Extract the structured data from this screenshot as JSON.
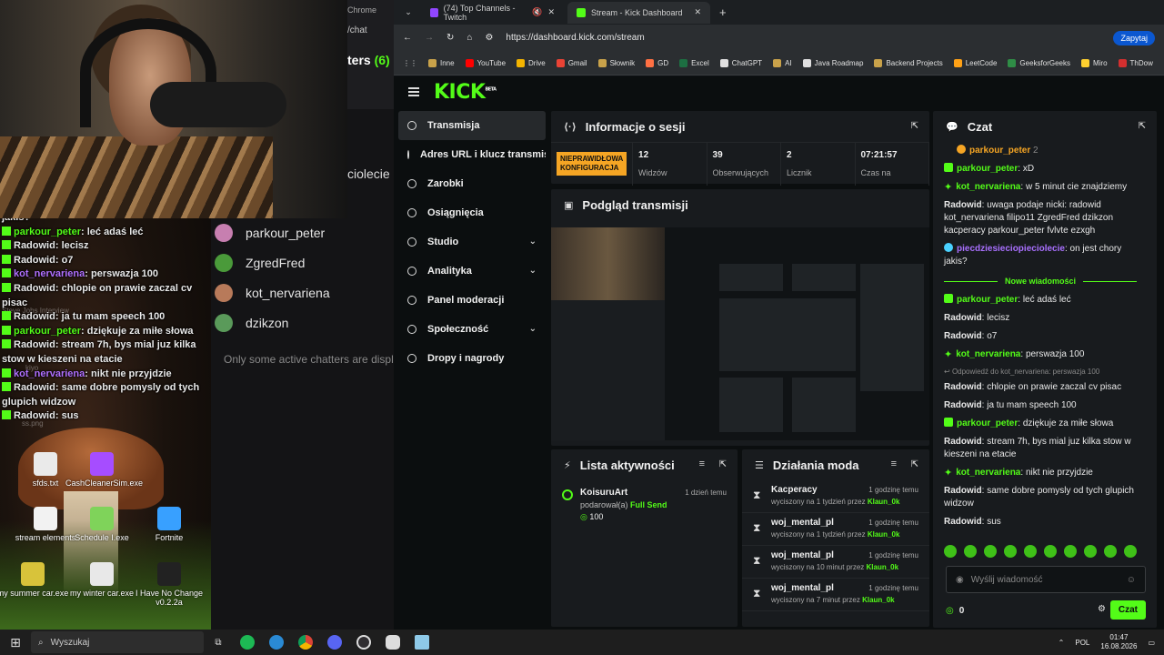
{
  "desktop": {
    "icons": [
      {
        "label": "sfds.txt",
        "color": "#eaeaea"
      },
      {
        "label": "CashCleanerSim.exe",
        "color": "#a64dff"
      },
      {
        "label": "stream elements",
        "color": "#f2f2f2"
      },
      {
        "label": "Schedule I.exe",
        "color": "#7fd35a"
      },
      {
        "label": "Fortnite",
        "color": "#38a0ff"
      },
      {
        "label": "my summer car.exe",
        "color": "#d8c33a"
      },
      {
        "label": "my winter car.exe",
        "color": "#e8e8e8"
      },
      {
        "label": "I Have No Change v0.2.2a",
        "color": "#222"
      }
    ],
    "faint_labels": [
      "Steve Jobs Interview",
      "kiyo",
      "ss.png"
    ]
  },
  "overlay_chat": {
    "first_line": "jakis?",
    "messages": [
      {
        "user": "parkour_peter",
        "text": "leć adaś leć",
        "color": "green"
      },
      {
        "user": "Radowid",
        "text": "lecisz",
        "color": "white"
      },
      {
        "user": "Radowid",
        "text": "o7",
        "color": "white"
      },
      {
        "user": "kot_nervariena",
        "text": "perswazja 100",
        "color": "purple"
      },
      {
        "user": "Radowid",
        "text": "chlopie on prawie zaczal cv pisac",
        "color": "white"
      },
      {
        "user": "Radowid",
        "text": "ja tu mam speech 100",
        "color": "white"
      },
      {
        "user": "parkour_peter",
        "text": "dziękuje za miłe słowa",
        "color": "green"
      },
      {
        "user": "Radowid",
        "text": "stream 7h, bys mial juz kilka stow w kieszeni na etacie",
        "color": "white"
      },
      {
        "user": "kot_nervariena",
        "text": "nikt nie przyjdzie",
        "color": "purple"
      },
      {
        "user": "Radowid",
        "text": "same dobre pomysly od tych glupich widzow",
        "color": "white"
      },
      {
        "user": "Radowid",
        "text": "sus",
        "color": "white"
      }
    ]
  },
  "twitch": {
    "chrome_label": "Chrome",
    "chat_url": "/chat",
    "chatters_label": "ters",
    "chatters_count": "(6)",
    "partial_name": "ciolecie",
    "chatters": [
      {
        "name": "parkour_peter",
        "color": "#c77fb0"
      },
      {
        "name": "ZgredFred",
        "color": "#4a9a3a"
      },
      {
        "name": "kot_nervariena",
        "color": "#b87a5a"
      },
      {
        "name": "dzikzon",
        "color": "#5a9a5a"
      }
    ],
    "note": "Only some active chatters are displayed"
  },
  "browser": {
    "tabs": [
      {
        "label": "(74) Top Channels - Twitch",
        "icon_color": "#9146ff"
      },
      {
        "label": "Stream - Kick Dashboard",
        "icon_color": "#53fc18"
      }
    ],
    "url": "https://dashboard.kick.com/stream",
    "ask_label": "Zapytaj",
    "bookmarks": [
      {
        "label": "Inne",
        "color": "#c9a24a"
      },
      {
        "label": "YouTube",
        "color": "#ff0000"
      },
      {
        "label": "Drive",
        "color": "#f4b400"
      },
      {
        "label": "Gmail",
        "color": "#ea4335"
      },
      {
        "label": "Słownik",
        "color": "#c9a24a"
      },
      {
        "label": "GD",
        "color": "#ff7043"
      },
      {
        "label": "Excel",
        "color": "#1d6f42"
      },
      {
        "label": "ChatGPT",
        "color": "#e0e0e0"
      },
      {
        "label": "AI",
        "color": "#c9a24a"
      },
      {
        "label": "Java Roadmap",
        "color": "#e0e0e0"
      },
      {
        "label": "Backend Projects",
        "color": "#c9a24a"
      },
      {
        "label": "LeetCode",
        "color": "#ffa116"
      },
      {
        "label": "GeeksforGeeks",
        "color": "#2f8d46"
      },
      {
        "label": "Miro",
        "color": "#ffd02f"
      },
      {
        "label": "ThDow",
        "color": "#d32f2f"
      }
    ]
  },
  "kick": {
    "logo": "KICK",
    "logo_sup": "BETA",
    "nav": [
      {
        "label": "Transmisja",
        "active": true,
        "chevron": false
      },
      {
        "label": "Adres URL i klucz transmisji",
        "active": false,
        "chevron": false
      },
      {
        "label": "Zarobki",
        "active": false,
        "chevron": false
      },
      {
        "label": "Osiągnięcia",
        "active": false,
        "chevron": false
      },
      {
        "label": "Studio",
        "active": false,
        "chevron": true
      },
      {
        "label": "Analityka",
        "active": false,
        "chevron": true
      },
      {
        "label": "Panel moderacji",
        "active": false,
        "chevron": false
      },
      {
        "label": "Społeczność",
        "active": false,
        "chevron": true
      },
      {
        "label": "Dropy i nagrody",
        "active": false,
        "chevron": false
      }
    ],
    "session": {
      "title": "Informacje o sesji",
      "warning": "NIEPRAWIDŁOWA KONFIGURACJA",
      "stats": [
        {
          "value": "12",
          "label": "Widzów"
        },
        {
          "value": "39",
          "label": "Obserwujących"
        },
        {
          "value": "2",
          "label": "Licznik"
        },
        {
          "value": "07:21:57",
          "label": "Czas na"
        }
      ]
    },
    "preview": {
      "title": "Podgląd transmisji"
    },
    "activity": {
      "title": "Lista aktywności",
      "items": [
        {
          "user": "KoisuruArt",
          "action": "podarował(a)",
          "item": "Full Send",
          "amount": "100",
          "time": "1 dzień temu"
        }
      ]
    },
    "mod_actions": {
      "title": "Działania moda",
      "items": [
        {
          "user": "Kacperacy",
          "text": "wyciszony na 1 tydzień przez",
          "by": "Klaun_0k",
          "time": "1 godzinę temu"
        },
        {
          "user": "woj_mental_pl",
          "text": "wyciszony na 1 tydzień przez",
          "by": "Klaun_0k",
          "time": "1 godzinę temu"
        },
        {
          "user": "woj_mental_pl",
          "text": "wyciszony na 10 minut przez",
          "by": "Klaun_0k",
          "time": "1 godzinę temu"
        },
        {
          "user": "woj_mental_pl",
          "text": "wyciszony na 7 minut przez",
          "by": "Klaun_0k",
          "time": "1 godzinę temu"
        }
      ]
    },
    "chat": {
      "title": "Czat",
      "pinned_user": "parkour_peter",
      "pinned_count": "2",
      "new_messages_label": "Nowe wiadomości",
      "reply_note": "Odpowiedź do kot_nervariena: perswazja 100",
      "messages_before": [
        {
          "user": "parkour_peter",
          "text": "xD",
          "style": "green",
          "badge": "sub"
        },
        {
          "user": "kot_nervariena",
          "text": "w 5 minut cie znajdziemy",
          "style": "green",
          "badge": "star"
        },
        {
          "user": "Radowid",
          "text": "uwaga podaje nicki: radowid kot_nervariena filipo11 ZgredFred dzikzon kacperacy parkour_peter fvlvte ezxgh",
          "style": "white",
          "badge": ""
        },
        {
          "user": "piecdziesieciopieciolecie",
          "text": "on jest chory jakis?",
          "style": "purple",
          "badge": "tsub"
        }
      ],
      "messages_after": [
        {
          "user": "parkour_peter",
          "text": "leć adaś leć",
          "style": "green",
          "badge": "sub"
        },
        {
          "user": "Radowid",
          "text": "lecisz",
          "style": "white",
          "badge": ""
        },
        {
          "user": "Radowid",
          "text": "o7",
          "style": "white",
          "badge": ""
        },
        {
          "user": "kot_nervariena",
          "text": "perswazja 100",
          "style": "green",
          "badge": "star"
        }
      ],
      "messages_reply": [
        {
          "user": "Radowid",
          "text": "chlopie on prawie zaczal cv pisac",
          "style": "white",
          "badge": ""
        },
        {
          "user": "Radowid",
          "text": "ja tu mam speech 100",
          "style": "white",
          "badge": ""
        },
        {
          "user": "parkour_peter",
          "text": "dziękuje za miłe słowa",
          "style": "green",
          "badge": "sub"
        },
        {
          "user": "Radowid",
          "text": "stream 7h, bys mial juz kilka stow w kieszeni na etacie",
          "style": "white",
          "badge": ""
        },
        {
          "user": "kot_nervariena",
          "text": "nikt nie przyjdzie",
          "style": "green",
          "badge": "star"
        },
        {
          "user": "Radowid",
          "text": "same dobre pomysly od tych glupich widzow",
          "style": "white",
          "badge": ""
        },
        {
          "user": "Radowid",
          "text": "sus",
          "style": "white",
          "badge": ""
        }
      ],
      "input_placeholder": "Wyślij wiadomość",
      "points": "0",
      "send_label": "Czat"
    }
  },
  "taskbar": {
    "search_placeholder": "Wyszukaj",
    "lang": "POL",
    "time": "01:47",
    "date": "16.08.2026"
  }
}
